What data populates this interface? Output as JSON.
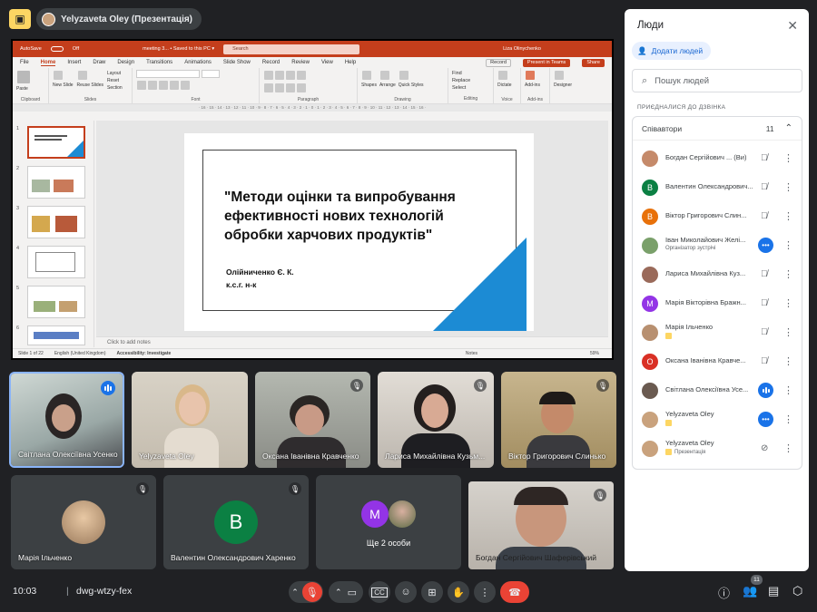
{
  "top": {
    "presenter_chip": "Yelyzaveta Oley (Презентація)"
  },
  "ppt": {
    "autosave": "AutoSave",
    "autosave_state": "Off",
    "filename": "meeting 3... • Saved to this PC ▾",
    "search": "Search",
    "user": "Liza Olinychenko",
    "menu": [
      "File",
      "Home",
      "Insert",
      "Draw",
      "Design",
      "Transitions",
      "Animations",
      "Slide Show",
      "Record",
      "Review",
      "View",
      "Help"
    ],
    "record_btn": "Record",
    "present_btn": "Present in Teams",
    "share_btn": "Share",
    "ribbon_groups": [
      "Clipboard",
      "Slides",
      "Font",
      "Paragraph",
      "Drawing",
      "Editing",
      "Voice",
      "Add-ins"
    ],
    "ribbon_items": {
      "paste": "Paste",
      "new_slide": "New Slide",
      "reuse": "Reuse Slides",
      "layout": "Layout",
      "reset": "Reset",
      "section": "Section",
      "shapes": "Shapes",
      "arrange": "Arrange",
      "quick_styles": "Quick Styles",
      "find": "Find",
      "replace": "Replace",
      "select": "Select",
      "dictate": "Dictate",
      "addins": "Add-ins",
      "designer": "Designer"
    },
    "slide": {
      "title": "\"Методи оцінки та випробування ефективності нових технологій обробки харчових продуктів\"",
      "author": "Олійниченко Є. К.",
      "degree": "к.с.г. н-к"
    },
    "notes_placeholder": "Click to add notes",
    "status": {
      "slide": "Slide 1 of 22",
      "lang": "English (United Kingdom)",
      "access": "Accessibility: Investigate",
      "notes": "Notes",
      "zoom": "59%"
    },
    "thumb_numbers": [
      "1",
      "2",
      "3",
      "4",
      "5",
      "6"
    ]
  },
  "tiles_row1": [
    {
      "name": "Світлана Олексіївна Усенко",
      "state": "speaking"
    },
    {
      "name": "Yelyzaveta Oley",
      "state": "none"
    },
    {
      "name": "Оксана Іванівна Кравченко",
      "state": "muted"
    },
    {
      "name": "Лариса Михайлівна Кузьм...",
      "state": "muted"
    },
    {
      "name": "Віктор Григорович Слинько",
      "state": "muted"
    }
  ],
  "tiles_row2": [
    {
      "name": "Марія Ільченко",
      "state": "muted"
    },
    {
      "name": "Валентин Олександрович Харенко",
      "state": "muted",
      "initial": "В"
    },
    {
      "name": "Ще 2 особи",
      "state": "none",
      "initial": "M"
    },
    {
      "name": "Богдан Сергійович Шаферівський",
      "state": "muted"
    }
  ],
  "panel": {
    "title": "Люди",
    "add_people": "Додати людей",
    "search_placeholder": "Пошук людей",
    "section": "ПРИЄДНАЛИСЯ ДО ДЗВІНКА",
    "group_label": "Співавтори",
    "group_count": "11",
    "people": [
      {
        "name": "Богдан Сергійович ... (Ви)",
        "sub": "",
        "initial": "",
        "color": "#c58a6a",
        "action": "mic-off"
      },
      {
        "name": "Валентин Олександрович...",
        "sub": "",
        "initial": "В",
        "color": "#0b8043",
        "action": "mic-off"
      },
      {
        "name": "Віктор Григорович Слин...",
        "sub": "",
        "initial": "В",
        "color": "#e8710a",
        "action": "mic-off"
      },
      {
        "name": "Іван Миколайович Желі...",
        "sub": "Організатор зустрічі",
        "initial": "",
        "color": "#7aa06a",
        "action": "more-blue"
      },
      {
        "name": "Лариса Михайлівна Куз...",
        "sub": "",
        "initial": "",
        "color": "#9a6a5a",
        "action": "mic-off"
      },
      {
        "name": "Марія Вікторівна Бражн...",
        "sub": "",
        "initial": "М",
        "color": "#9334e6",
        "action": "mic-off"
      },
      {
        "name": "Марія Ільченко",
        "sub": "",
        "initial": "",
        "color": "#b89070",
        "action": "mic-off"
      },
      {
        "name": "Оксана Іванівна Кравче...",
        "sub": "",
        "initial": "О",
        "color": "#d93025",
        "action": "mic-off"
      },
      {
        "name": "Світлана Олексіївна Усе...",
        "sub": "",
        "initial": "",
        "color": "#6a5a50",
        "action": "speaking"
      },
      {
        "name": "Yelyzaveta Oley",
        "sub": "",
        "initial": "",
        "color": "#c9a27d",
        "action": "more-blue"
      },
      {
        "name": "Yelyzaveta Oley",
        "sub": "Презентація",
        "initial": "",
        "color": "#c9a27d",
        "action": "present-off"
      }
    ]
  },
  "bottom": {
    "time": "10:03",
    "separator": "|",
    "code": "dwg-wtzy-fex",
    "people_count": "11"
  }
}
